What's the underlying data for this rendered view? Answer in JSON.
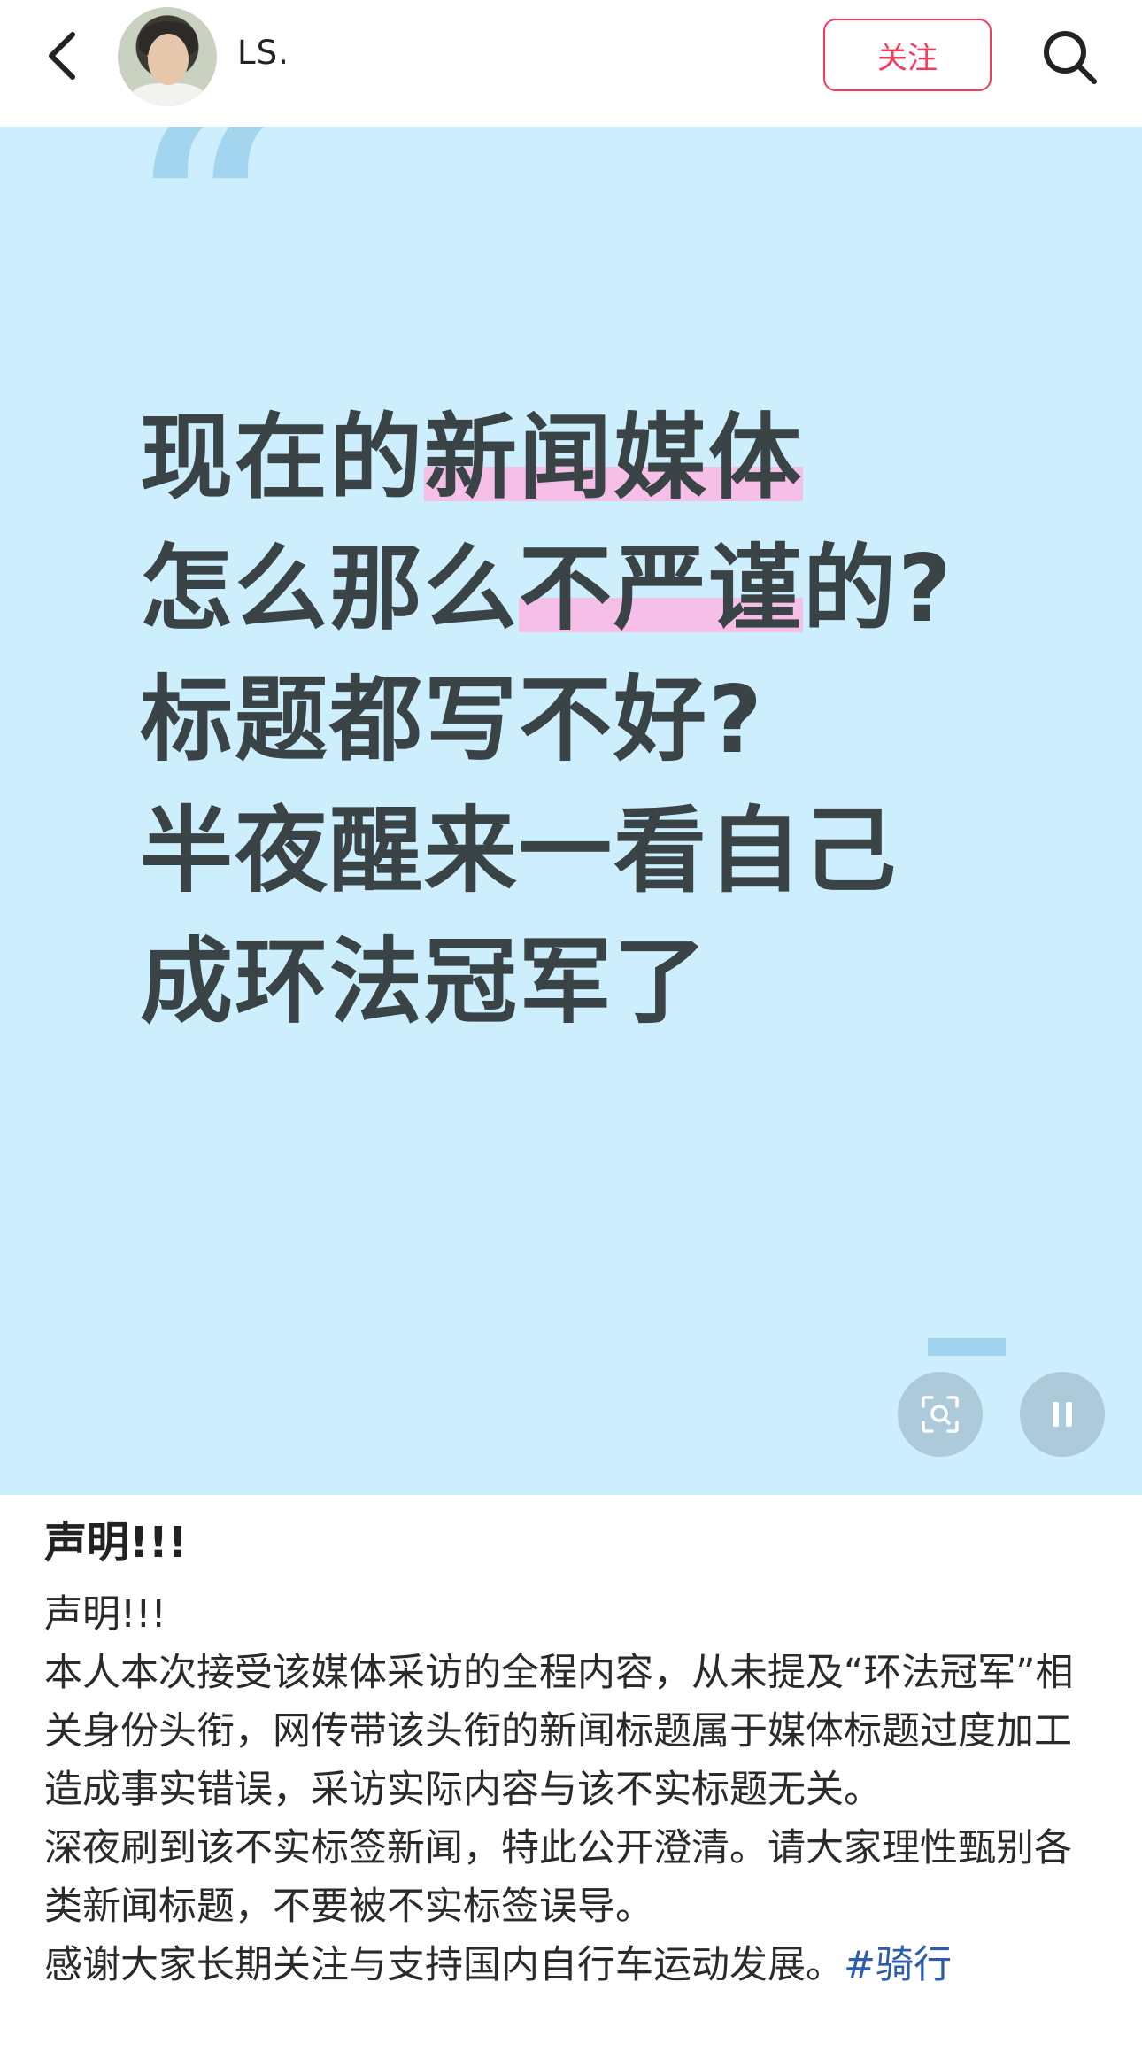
{
  "header": {
    "username": "LS.",
    "follow_label": "关注",
    "accent_color": "#f23c5f"
  },
  "media": {
    "background_color": "#cdeefc",
    "quote_mark": "“",
    "lines": [
      {
        "before": "现在的",
        "highlight": "新闻媒体",
        "after": ""
      },
      {
        "before": "怎么那么",
        "highlight": "不严谨",
        "after": "的?"
      },
      {
        "before": "标题都写不好?",
        "highlight": "",
        "after": ""
      },
      {
        "before": "半夜醒来一看自己",
        "highlight": "",
        "after": ""
      },
      {
        "before": "成环法冠军了",
        "highlight": "",
        "after": ""
      }
    ],
    "highlight_color": "#f6bfe8"
  },
  "post": {
    "title": "声明!!!",
    "paragraphs": [
      "声明!!!",
      "本人本次接受该媒体采访的全程内容，从未提及“环法冠军”相关身份头衔，网传带该头衔的新闻标题属于媒体标题过度加工造成事实错误，采访实际内容与该不实标题无关。",
      "深夜刷到该不实标签新闻，特此公开澄清。请大家理性甄别各类新闻标题，不要被不实标签误导。"
    ],
    "last_line": "感谢大家长期关注与支持国内自行车运动发展。",
    "hashtag": "#骑行",
    "hashtag_color": "#2b5cae"
  }
}
